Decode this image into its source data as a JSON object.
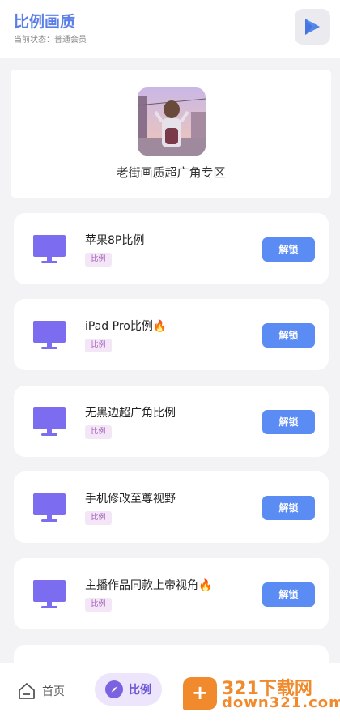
{
  "header": {
    "title": "比例画质",
    "status": "当前状态：普通会员"
  },
  "banner": {
    "title": "老街画质超广角专区"
  },
  "items": [
    {
      "title": "苹果8P比例",
      "tag": "比例",
      "button": "解锁"
    },
    {
      "title": "iPad Pro比例🔥",
      "tag": "比例",
      "button": "解锁"
    },
    {
      "title": "无黑边超广角比例",
      "tag": "比例",
      "button": "解锁"
    },
    {
      "title": "手机修改至尊视野",
      "tag": "比例",
      "button": "解锁"
    },
    {
      "title": "主播作品同款上帝视角🔥",
      "tag": "比例",
      "button": "解锁"
    }
  ],
  "tabs": {
    "home": "首页",
    "ratio": "比例"
  },
  "watermark": {
    "badge": "+",
    "top": "321下载网",
    "bottom": "down321.com"
  },
  "colors": {
    "accent": "#5b7fe6",
    "button": "#5b8cf4",
    "monitor": "#7b6cf0",
    "tab_active": "#7a62e0",
    "watermark": "#f08a2c"
  },
  "icons": {
    "header_action": "play-triangle-icon",
    "item": "monitor-icon",
    "home_tab": "home-icon",
    "ratio_tab": "compass-icon"
  }
}
